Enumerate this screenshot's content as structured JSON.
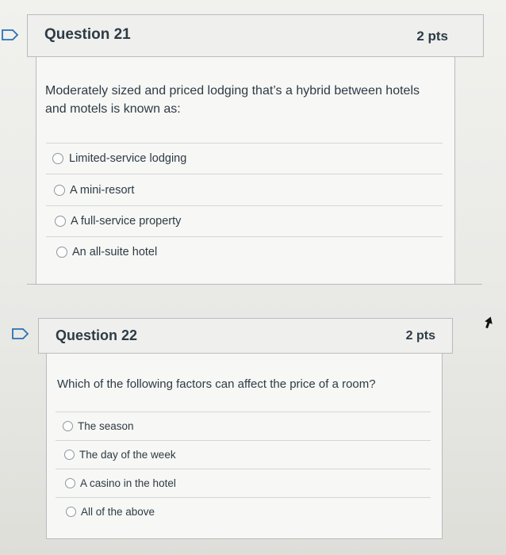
{
  "questions": [
    {
      "title": "Question 21",
      "points": "2 pts",
      "text": "Moderately sized and priced lodging that’s a hybrid between hotels and motels is known as:",
      "answers": [
        {
          "label": "Limited-service lodging",
          "selected": false
        },
        {
          "label": "A mini-resort",
          "selected": false
        },
        {
          "label": "A full-service property",
          "selected": false
        },
        {
          "label": "An all-suite hotel",
          "selected": false
        }
      ]
    },
    {
      "title": "Question 22",
      "points": "2 pts",
      "text": "Which of the following factors can affect the price of a room?",
      "answers": [
        {
          "label": "The season",
          "selected": false
        },
        {
          "label": "The day of the week",
          "selected": false
        },
        {
          "label": "A casino in the hotel",
          "selected": false
        },
        {
          "label": "All of the above",
          "selected": false
        }
      ]
    }
  ],
  "colors": {
    "flag": "#2b6fb6",
    "text": "#2d3b45",
    "border": "#b8bcbe"
  },
  "icons": [
    "flag-icon",
    "radio-unchecked-icon",
    "mouse-pointer-icon"
  ]
}
